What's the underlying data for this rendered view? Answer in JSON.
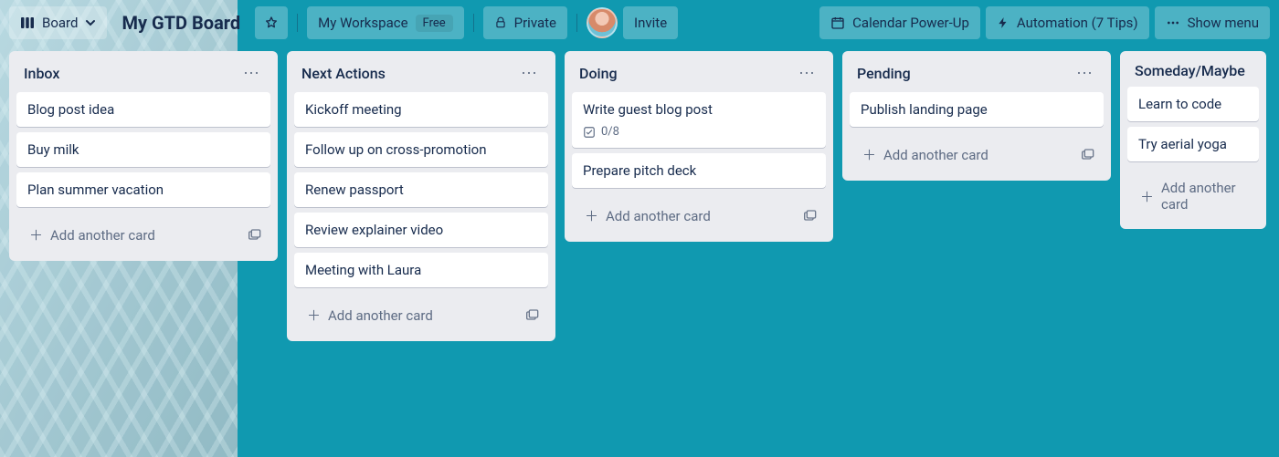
{
  "header": {
    "view_label": "Board",
    "board_title": "My GTD Board",
    "workspace": "My Workspace",
    "workspace_tier": "Free",
    "visibility": "Private",
    "invite": "Invite",
    "calendar": "Calendar Power-Up",
    "automation": "Automation (7 Tips)",
    "show_menu": "Show menu"
  },
  "lists": [
    {
      "title": "Inbox",
      "cards": [
        {
          "title": "Blog post idea"
        },
        {
          "title": "Buy milk"
        },
        {
          "title": "Plan summer vacation"
        }
      ]
    },
    {
      "title": "Next Actions",
      "cards": [
        {
          "title": "Kickoff meeting"
        },
        {
          "title": "Follow up on cross-promotion"
        },
        {
          "title": "Renew passport"
        },
        {
          "title": "Review explainer video"
        },
        {
          "title": "Meeting with Laura"
        }
      ]
    },
    {
      "title": "Doing",
      "cards": [
        {
          "title": "Write guest blog post",
          "checklist": "0/8"
        },
        {
          "title": "Prepare pitch deck"
        }
      ]
    },
    {
      "title": "Pending",
      "cards": [
        {
          "title": "Publish landing page"
        }
      ]
    },
    {
      "title": "Someday/Maybe",
      "cards": [
        {
          "title": "Learn to code"
        },
        {
          "title": "Try aerial yoga"
        }
      ]
    }
  ],
  "labels": {
    "add_another_card": "Add another card"
  }
}
